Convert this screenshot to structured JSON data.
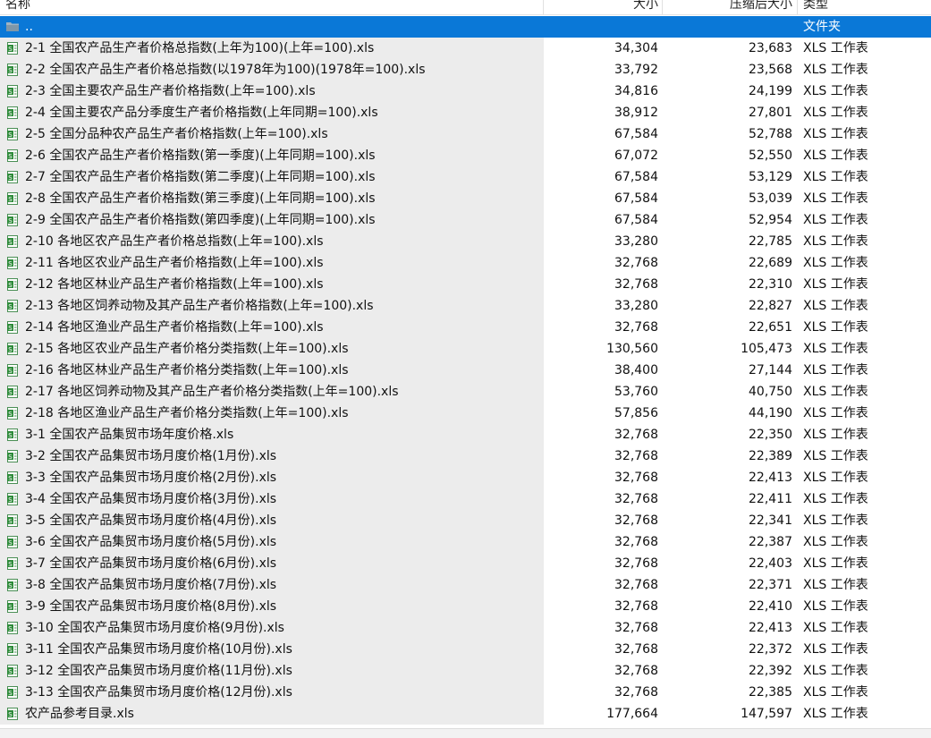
{
  "columns": {
    "name": "名称",
    "size": "大小",
    "compressed": "压缩后大小",
    "type": "类型"
  },
  "parent_row": {
    "name": "..",
    "type": "文件夹",
    "icon": "folder-icon"
  },
  "file_icon": "spreadsheet-file-icon",
  "colors": {
    "selection": "#0a78d7",
    "icon_green": "#2e8b3a"
  },
  "files": [
    {
      "name": "2-1 全国农产品生产者价格总指数(上年为100)(上年=100).xls",
      "size": "34,304",
      "compressed": "23,683",
      "type": "XLS 工作表"
    },
    {
      "name": "2-2 全国农产品生产者价格总指数(以1978年为100)(1978年=100).xls",
      "size": "33,792",
      "compressed": "23,568",
      "type": "XLS 工作表"
    },
    {
      "name": "2-3 全国主要农产品生产者价格指数(上年=100).xls",
      "size": "34,816",
      "compressed": "24,199",
      "type": "XLS 工作表"
    },
    {
      "name": "2-4 全国主要农产品分季度生产者价格指数(上年同期=100).xls",
      "size": "38,912",
      "compressed": "27,801",
      "type": "XLS 工作表"
    },
    {
      "name": "2-5 全国分品种农产品生产者价格指数(上年=100).xls",
      "size": "67,584",
      "compressed": "52,788",
      "type": "XLS 工作表"
    },
    {
      "name": "2-6 全国农产品生产者价格指数(第一季度)(上年同期=100).xls",
      "size": "67,072",
      "compressed": "52,550",
      "type": "XLS 工作表"
    },
    {
      "name": "2-7 全国农产品生产者价格指数(第二季度)(上年同期=100).xls",
      "size": "67,584",
      "compressed": "53,129",
      "type": "XLS 工作表"
    },
    {
      "name": "2-8 全国农产品生产者价格指数(第三季度)(上年同期=100).xls",
      "size": "67,584",
      "compressed": "53,039",
      "type": "XLS 工作表"
    },
    {
      "name": "2-9 全国农产品生产者价格指数(第四季度)(上年同期=100).xls",
      "size": "67,584",
      "compressed": "52,954",
      "type": "XLS 工作表"
    },
    {
      "name": "2-10 各地区农产品生产者价格总指数(上年=100).xls",
      "size": "33,280",
      "compressed": "22,785",
      "type": "XLS 工作表"
    },
    {
      "name": "2-11 各地区农业产品生产者价格指数(上年=100).xls",
      "size": "32,768",
      "compressed": "22,689",
      "type": "XLS 工作表"
    },
    {
      "name": "2-12 各地区林业产品生产者价格指数(上年=100).xls",
      "size": "32,768",
      "compressed": "22,310",
      "type": "XLS 工作表"
    },
    {
      "name": "2-13 各地区饲养动物及其产品生产者价格指数(上年=100).xls",
      "size": "33,280",
      "compressed": "22,827",
      "type": "XLS 工作表"
    },
    {
      "name": "2-14 各地区渔业产品生产者价格指数(上年=100).xls",
      "size": "32,768",
      "compressed": "22,651",
      "type": "XLS 工作表"
    },
    {
      "name": "2-15 各地区农业产品生产者价格分类指数(上年=100).xls",
      "size": "130,560",
      "compressed": "105,473",
      "type": "XLS 工作表"
    },
    {
      "name": "2-16 各地区林业产品生产者价格分类指数(上年=100).xls",
      "size": "38,400",
      "compressed": "27,144",
      "type": "XLS 工作表"
    },
    {
      "name": "2-17 各地区饲养动物及其产品生产者价格分类指数(上年=100).xls",
      "size": "53,760",
      "compressed": "40,750",
      "type": "XLS 工作表"
    },
    {
      "name": "2-18 各地区渔业产品生产者价格分类指数(上年=100).xls",
      "size": "57,856",
      "compressed": "44,190",
      "type": "XLS 工作表"
    },
    {
      "name": "3-1 全国农产品集贸市场年度价格.xls",
      "size": "32,768",
      "compressed": "22,350",
      "type": "XLS 工作表"
    },
    {
      "name": "3-2 全国农产品集贸市场月度价格(1月份).xls",
      "size": "32,768",
      "compressed": "22,389",
      "type": "XLS 工作表"
    },
    {
      "name": "3-3 全国农产品集贸市场月度价格(2月份).xls",
      "size": "32,768",
      "compressed": "22,413",
      "type": "XLS 工作表"
    },
    {
      "name": "3-4 全国农产品集贸市场月度价格(3月份).xls",
      "size": "32,768",
      "compressed": "22,411",
      "type": "XLS 工作表"
    },
    {
      "name": "3-5 全国农产品集贸市场月度价格(4月份).xls",
      "size": "32,768",
      "compressed": "22,341",
      "type": "XLS 工作表"
    },
    {
      "name": "3-6 全国农产品集贸市场月度价格(5月份).xls",
      "size": "32,768",
      "compressed": "22,387",
      "type": "XLS 工作表"
    },
    {
      "name": "3-7 全国农产品集贸市场月度价格(6月份).xls",
      "size": "32,768",
      "compressed": "22,403",
      "type": "XLS 工作表"
    },
    {
      "name": "3-8 全国农产品集贸市场月度价格(7月份).xls",
      "size": "32,768",
      "compressed": "22,371",
      "type": "XLS 工作表"
    },
    {
      "name": "3-9 全国农产品集贸市场月度价格(8月份).xls",
      "size": "32,768",
      "compressed": "22,410",
      "type": "XLS 工作表"
    },
    {
      "name": "3-10 全国农产品集贸市场月度价格(9月份).xls",
      "size": "32,768",
      "compressed": "22,413",
      "type": "XLS 工作表"
    },
    {
      "name": "3-11 全国农产品集贸市场月度价格(10月份).xls",
      "size": "32,768",
      "compressed": "22,372",
      "type": "XLS 工作表"
    },
    {
      "name": "3-12 全国农产品集贸市场月度价格(11月份).xls",
      "size": "32,768",
      "compressed": "22,392",
      "type": "XLS 工作表"
    },
    {
      "name": "3-13 全国农产品集贸市场月度价格(12月份).xls",
      "size": "32,768",
      "compressed": "22,385",
      "type": "XLS 工作表"
    },
    {
      "name": "农产品参考目录.xls",
      "size": "177,664",
      "compressed": "147,597",
      "type": "XLS 工作表"
    }
  ]
}
